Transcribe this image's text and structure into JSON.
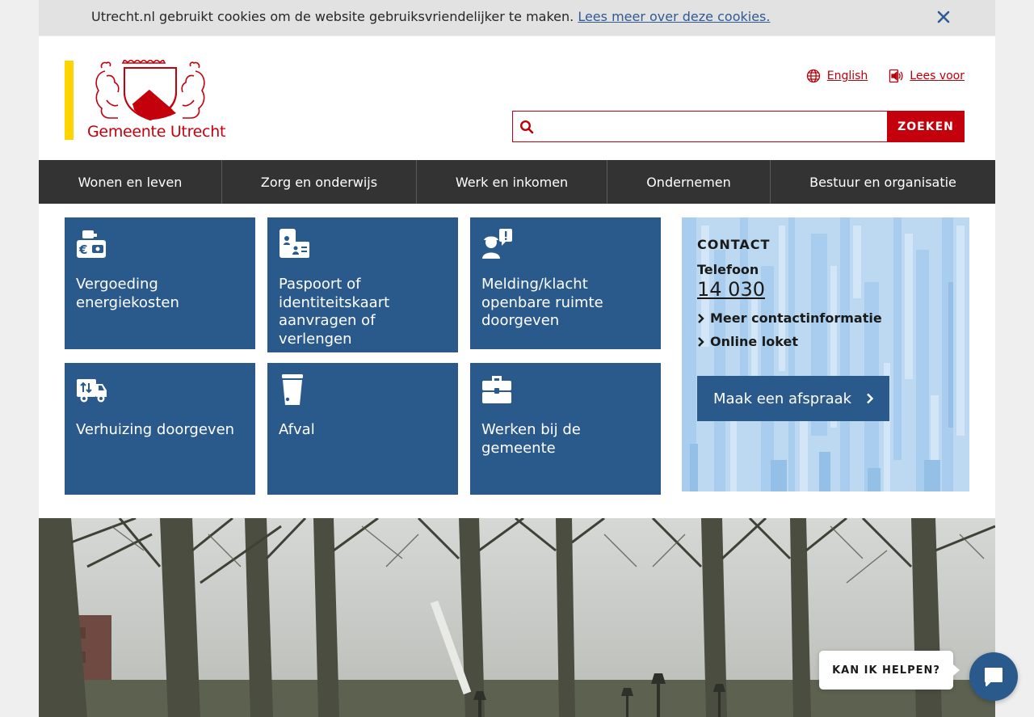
{
  "cookie": {
    "text": "Utrecht.nl gebruikt cookies om de website gebruiksvriendelijker te maken.",
    "link": "Lees meer over deze cookies.",
    "close_icon": "close-icon"
  },
  "header": {
    "logo_text": "Gemeente Utrecht",
    "links": {
      "english": "English",
      "read_aloud": "Lees voor"
    },
    "search": {
      "placeholder": "",
      "button": "ZOEKEN"
    }
  },
  "nav": {
    "items": [
      "Wonen en leven",
      "Zorg en onderwijs",
      "Werk en inkomen",
      "Ondernemen",
      "Bestuur en organisatie"
    ]
  },
  "tiles": [
    {
      "label": "Vergoeding energiekosten",
      "icon": "euro-wallet-icon"
    },
    {
      "label": "Paspoort of identiteitskaart aanvragen of verlengen",
      "icon": "passport-id-icon"
    },
    {
      "label": "Melding/klacht openbare ruimte doorgeven",
      "icon": "report-person-icon"
    },
    {
      "label": "Verhuizing doorgeven",
      "icon": "moving-truck-icon"
    },
    {
      "label": "Afval",
      "icon": "trash-can-icon"
    },
    {
      "label": "Werken bij de gemeente",
      "icon": "briefcase-icon"
    }
  ],
  "contact": {
    "heading": "CONTACT",
    "phone_label": "Telefoon",
    "phone": "14 030",
    "links": [
      "Meer contactinformatie",
      "Online loket"
    ],
    "appointment_button": "Maak een afspraak"
  },
  "chat": {
    "bubble": "KAN IK HELPEN?",
    "icon": "chat-bubble-icon"
  },
  "colors": {
    "brand_red": "#c5000d",
    "tile_blue": "#2a5a8c",
    "nav_dark": "#333333",
    "logo_yellow": "#ffd400"
  }
}
